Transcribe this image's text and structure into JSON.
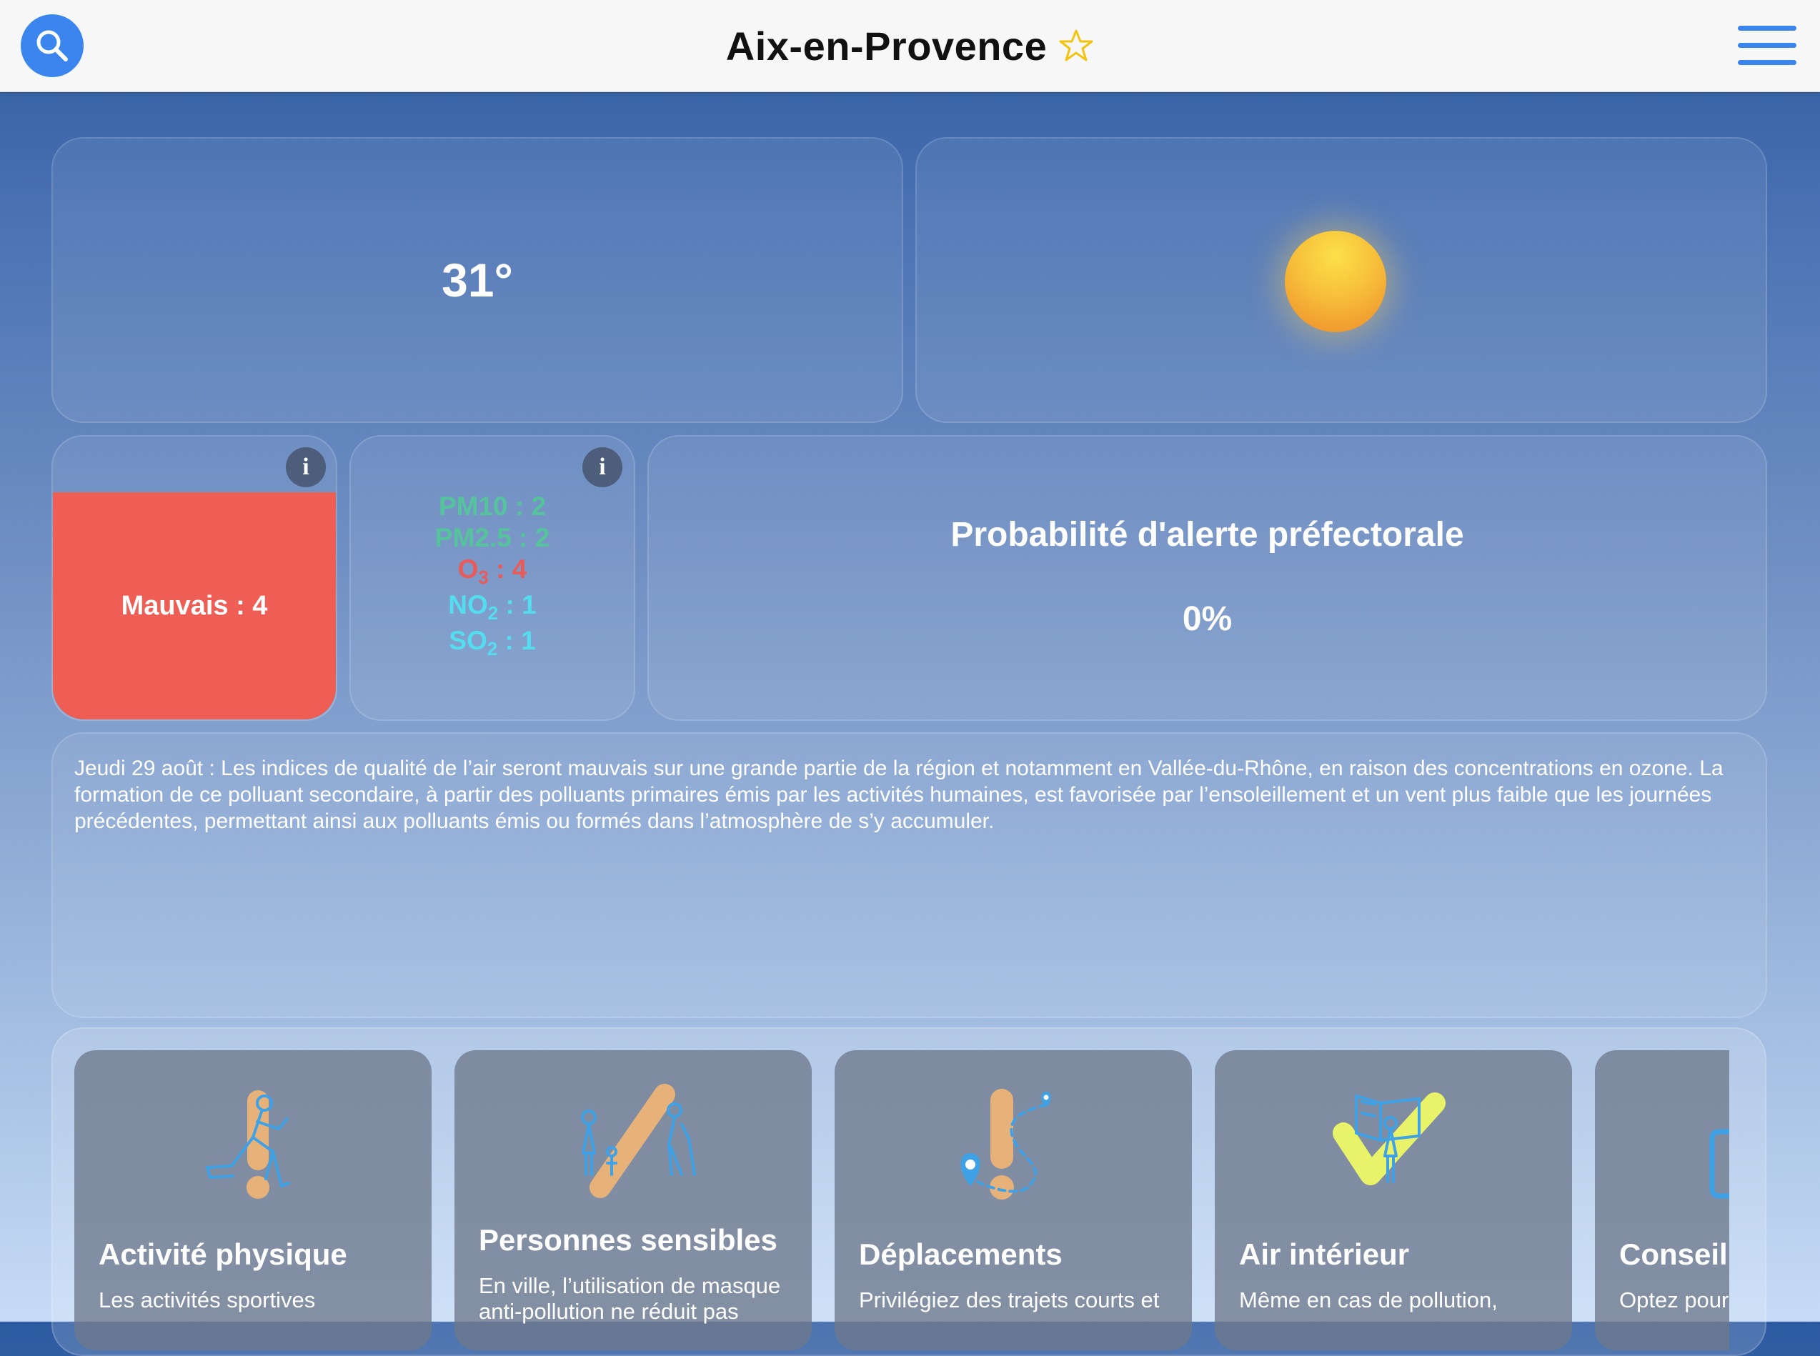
{
  "header": {
    "city": "Aix-en-Provence"
  },
  "weather": {
    "temperature": "31°",
    "condition_icon": "sun-icon"
  },
  "air_quality": {
    "index_label": "Mauvais : 4",
    "index_color": "#ee5e55",
    "pollutants": [
      {
        "name": "PM10",
        "sub": "",
        "value": " : 2",
        "color": "#55c39c"
      },
      {
        "name": "PM2.5",
        "sub": "",
        "value": " : 2",
        "color": "#55c39c"
      },
      {
        "name": "O",
        "sub": "3",
        "value": " : 4",
        "color": "#ea5a58"
      },
      {
        "name": "NO",
        "sub": "2",
        "value": " : 1",
        "color": "#54dcef"
      },
      {
        "name": "SO",
        "sub": "2",
        "value": " : 1",
        "color": "#54dcef"
      }
    ]
  },
  "alert": {
    "title": "Probabilité d'alerte préfectorale",
    "value": "0%"
  },
  "bulletin": {
    "text": "Jeudi 29 août : Les indices de qualité de l’air seront mauvais sur une grande partie de la région et notamment en Vallée-du-Rhône, en raison des concentrations en ozone. La formation de ce polluant secondaire, à partir des polluants primaires émis par les activités humaines, est favorisée par l’ensoleillement et un vent plus faible que les journées précédentes, permettant ainsi aux polluants émis ou formés dans l’atmosphère de s’y accumuler."
  },
  "tips": [
    {
      "title": "Activité physique",
      "text": "Les activités sportives",
      "icon": "physical-activity-icon"
    },
    {
      "title": "Personnes sensibles",
      "text": "En ville, l’utilisation de masque anti-pollution ne réduit pas",
      "icon": "sensitive-people-icon"
    },
    {
      "title": "Déplacements",
      "text": "Privilégiez des trajets courts et",
      "icon": "travel-icon"
    },
    {
      "title": "Air intérieur",
      "text": "Même en cas de pollution,",
      "icon": "indoor-air-icon"
    },
    {
      "title": "Conseil du jour",
      "text": "Optez pour les",
      "icon": "advice-icon"
    }
  ],
  "colors": {
    "accent": "#3a86ee",
    "favorite_star": "#f2c40f",
    "pm_good": "#55c39c",
    "pollutant_bad": "#ea5a58",
    "pollutant_low": "#54dcef"
  }
}
